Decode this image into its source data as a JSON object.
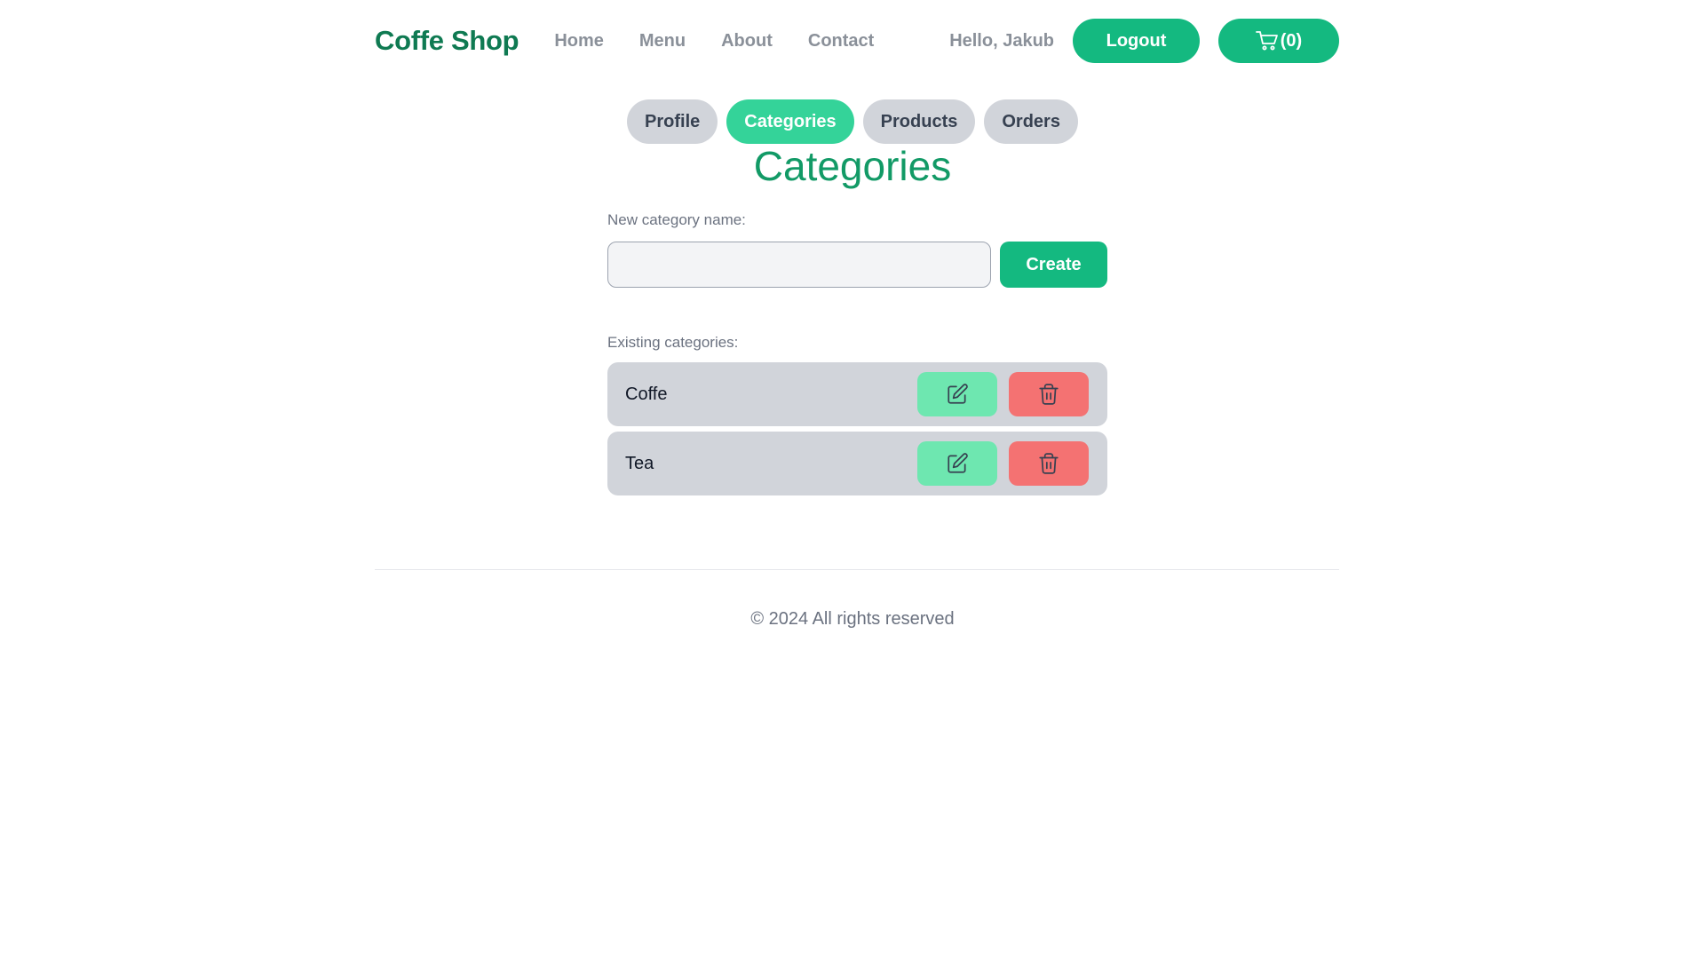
{
  "header": {
    "brand": "Coffe Shop",
    "nav": [
      "Home",
      "Menu",
      "About",
      "Contact"
    ],
    "greeting": "Hello, Jakub",
    "logout_label": "Logout",
    "cart_label": "(0)"
  },
  "tabs": [
    {
      "label": "Profile",
      "active": false
    },
    {
      "label": "Categories",
      "active": true
    },
    {
      "label": "Products",
      "active": false
    },
    {
      "label": "Orders",
      "active": false
    }
  ],
  "page": {
    "title": "Categories",
    "new_category_label": "New category name:",
    "new_category_value": "",
    "create_label": "Create",
    "existing_label": "Existing categories:"
  },
  "categories": [
    {
      "name": "Coffe"
    },
    {
      "name": "Tea"
    }
  ],
  "footer": {
    "text": "© 2024 All rights reserved"
  },
  "colors": {
    "brand": "#0f7a52",
    "primary": "#14b980",
    "active_tab": "#34d399",
    "edit": "#6ee7b0",
    "delete": "#f47272"
  },
  "icons": {
    "cart": "cart-icon",
    "edit": "edit-icon",
    "delete": "trash-icon"
  }
}
